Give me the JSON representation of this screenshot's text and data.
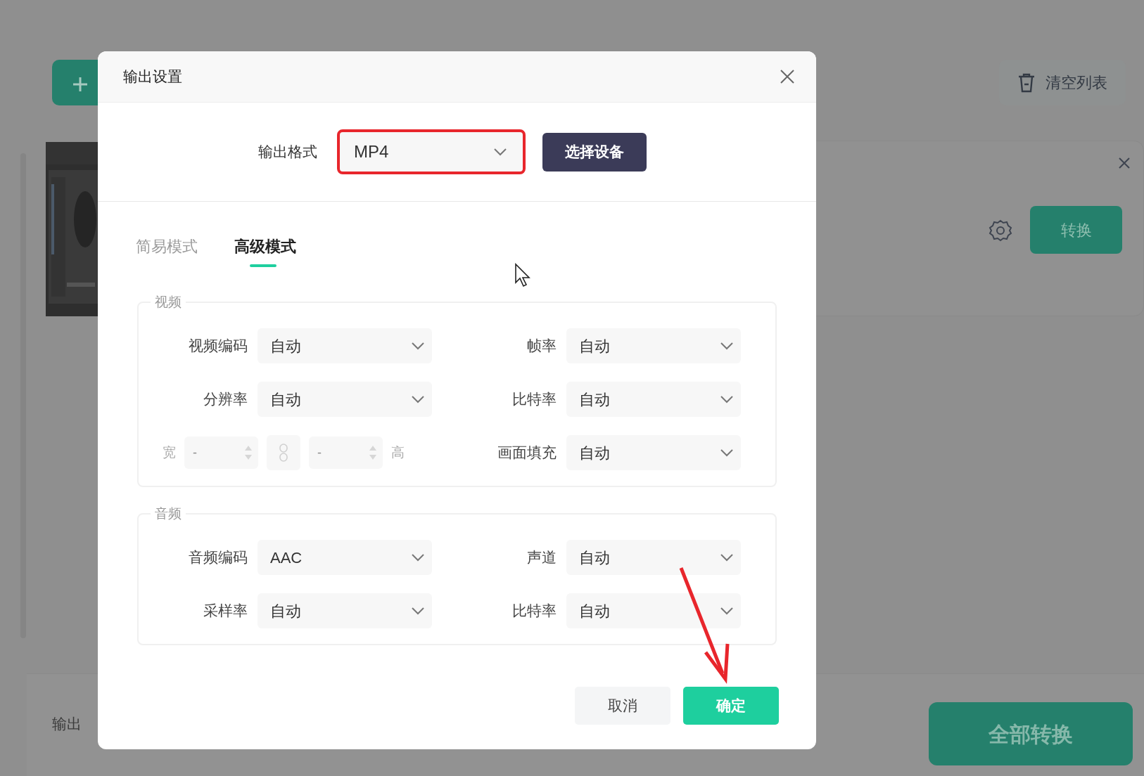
{
  "background": {
    "output_label": "输出",
    "clear_button": "清空列表",
    "convert_button": "转换",
    "convert_all_button": "全部转换"
  },
  "dialog": {
    "title": "输出设置",
    "format": {
      "label": "输出格式",
      "value": "MP4",
      "highlighted": true
    },
    "device_button": "选择设备",
    "tabs": [
      {
        "label": "简易模式",
        "selected": false
      },
      {
        "label": "高级模式",
        "selected": true
      }
    ],
    "sections": [
      {
        "title": "视频",
        "fields": [
          {
            "kind": "select",
            "label": "视频编码",
            "value": "自动"
          },
          {
            "kind": "select",
            "label": "帧率",
            "value": "自动"
          },
          {
            "kind": "select",
            "label": "分辨率",
            "value": "自动"
          },
          {
            "kind": "select",
            "label": "比特率",
            "value": "自动"
          },
          {
            "kind": "size",
            "width_label": "宽",
            "width_placeholder": "-",
            "height_placeholder": "-",
            "height_label": "高",
            "disabled": true
          },
          {
            "kind": "select",
            "label": "画面填充",
            "value": "自动"
          }
        ]
      },
      {
        "title": "音频",
        "fields": [
          {
            "kind": "select",
            "label": "音频编码",
            "value": "AAC"
          },
          {
            "kind": "select",
            "label": "声道",
            "value": "自动"
          },
          {
            "kind": "select",
            "label": "采样率",
            "value": "自动"
          },
          {
            "kind": "select",
            "label": "比特率",
            "value": "自动"
          }
        ]
      }
    ],
    "buttons": [
      {
        "label": "取消",
        "kind": "secondary"
      },
      {
        "label": "确定",
        "kind": "primary"
      }
    ]
  },
  "annotations": [
    {
      "kind": "arrow"
    }
  ]
}
